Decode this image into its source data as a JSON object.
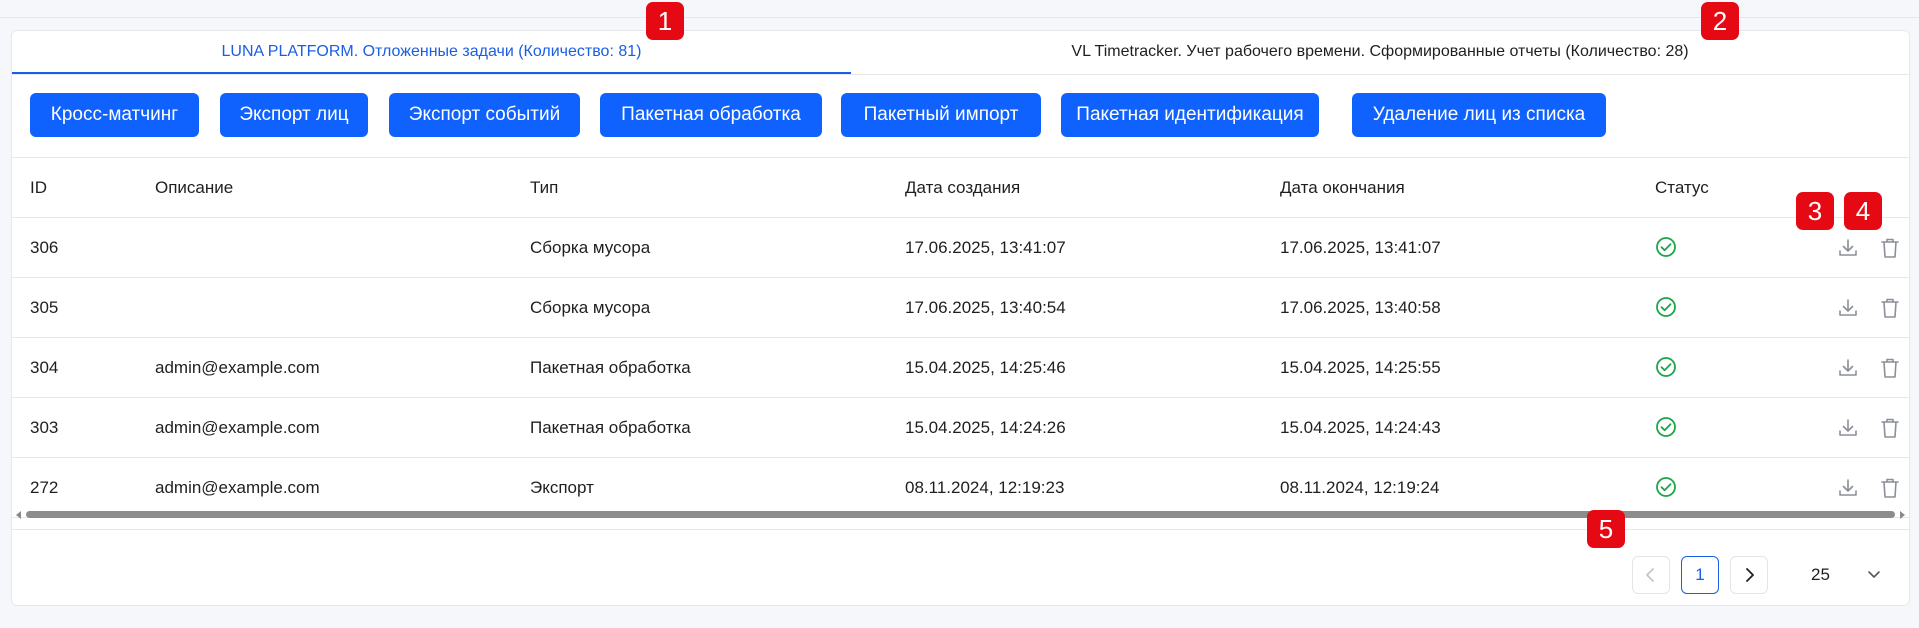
{
  "tabs": [
    {
      "label": "LUNA PLATFORM. Отложенные задачи (Количество: 81)",
      "active": true
    },
    {
      "label": "VL Timetracker. Учет рабочего времени. Сформированные отчеты (Количество: 28)",
      "active": false
    }
  ],
  "actions": [
    "Кросс-матчинг",
    "Экспорт лиц",
    "Экспорт событий",
    "Пакетная обработка",
    "Пакетный импорт",
    "Пакетная идентификация",
    "Удаление лиц из списка"
  ],
  "table": {
    "headers": {
      "id": "ID",
      "description": "Описание",
      "type": "Тип",
      "created": "Дата создания",
      "ended": "Дата окончания",
      "status": "Статус"
    },
    "rows": [
      {
        "id": "306",
        "description": "",
        "type": "Сборка мусора",
        "created": "17.06.2025, 13:41:07",
        "ended": "17.06.2025, 13:41:07",
        "status": "success"
      },
      {
        "id": "305",
        "description": "",
        "type": "Сборка мусора",
        "created": "17.06.2025, 13:40:54",
        "ended": "17.06.2025, 13:40:58",
        "status": "success"
      },
      {
        "id": "304",
        "description": "admin@example.com",
        "type": "Пакетная обработка",
        "created": "15.04.2025, 14:25:46",
        "ended": "15.04.2025, 14:25:55",
        "status": "success"
      },
      {
        "id": "303",
        "description": "admin@example.com",
        "type": "Пакетная обработка",
        "created": "15.04.2025, 14:24:26",
        "ended": "15.04.2025, 14:24:43",
        "status": "success"
      },
      {
        "id": "272",
        "description": "admin@example.com",
        "type": "Экспорт",
        "created": "08.11.2024, 12:19:23",
        "ended": "08.11.2024, 12:19:24",
        "status": "success"
      }
    ]
  },
  "pagination": {
    "current_page": "1",
    "page_size": "25"
  },
  "badges": [
    "1",
    "2",
    "3",
    "4",
    "5"
  ],
  "colors": {
    "accent": "#1a5ee6",
    "button": "#0f62fe",
    "success": "#1aa64a",
    "badge": "#e50914"
  },
  "icons": {
    "status": "check-circle-icon",
    "download": "download-icon",
    "delete": "trash-icon",
    "prev": "chevron-left-icon",
    "next": "chevron-right-icon",
    "select": "chevron-down-icon"
  }
}
